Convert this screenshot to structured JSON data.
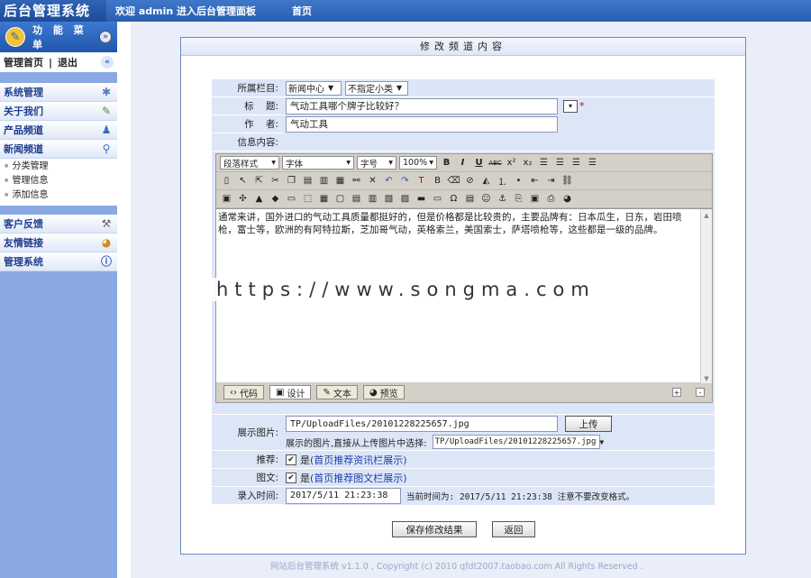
{
  "topbar": {
    "brand": "后台管理系统",
    "welcome": "欢迎 admin 进入后台管理面板",
    "home": "首页"
  },
  "sidebar": {
    "title": "功 能 菜 单",
    "quick_home": "管理首页",
    "quick_sep": "|",
    "quick_logout": "退出",
    "groups": [
      {
        "label": "系统管理"
      },
      {
        "label": "关于我们"
      },
      {
        "label": "产品频道"
      },
      {
        "label": "新闻频道"
      }
    ],
    "news_sub": [
      "分类管理",
      "管理信息",
      "添加信息"
    ],
    "groups2": [
      {
        "label": "客户反馈"
      },
      {
        "label": "友情链接"
      },
      {
        "label": "管理系统"
      }
    ]
  },
  "panel": {
    "title": "修改频道内容"
  },
  "form": {
    "category_label": "所属栏目:",
    "category_value": "新闻中心",
    "subcategory_value": "不指定小类",
    "title_label": "标    题:",
    "title_value": "气动工具哪个牌子比较好？",
    "author_label": "作    者:",
    "author_value": "气动工具",
    "content_label": "信息内容:",
    "editor": {
      "style_dd": "段落样式",
      "font_dd": "字体",
      "size_dd": "字号",
      "zoom_dd": "100%",
      "content": "通常来讲，国外进口的气动工具质量都挺好的，但是价格都是比较贵的，主要品牌有：日本瓜生，日东，岩田喷枪，富士等，欧洲的有阿特拉斯，芝加哥气动，英格索兰，美国索士，萨塔喷枪等，这些都是一级的品牌。",
      "modes": [
        "代码",
        "设计",
        "文本",
        "预览"
      ]
    },
    "image_label": "展示图片:",
    "image_value": "TP/UploadFiles/20101228225657.jpg",
    "upload_button": "上传",
    "choose_label": "展示的图片,直接从上传图片中选择:",
    "choose_value": "TP/UploadFiles/20101228225657.jpg",
    "recommend_label": "推荐:",
    "recommend_yes": "是",
    "recommend_link": "(首页推荐资讯栏展示)",
    "imagetext_label": "图文:",
    "imagetext_yes": "是",
    "imagetext_link": "(首页推荐图文栏展示)",
    "time_label": "录入时间:",
    "time_value": "2017/5/11 21:23:38",
    "current_time_text": "当前时间为: 2017/5/11 21:23:38 注意不要改变格式。",
    "save_button": "保存修改结果",
    "back_button": "返回"
  },
  "watermark": "https://www.songma.com",
  "footer": "网站后台管理系统 v1.1.0 , Copyright (c) 2010 qfdt2007.taobao.com All Rights Reserved ."
}
